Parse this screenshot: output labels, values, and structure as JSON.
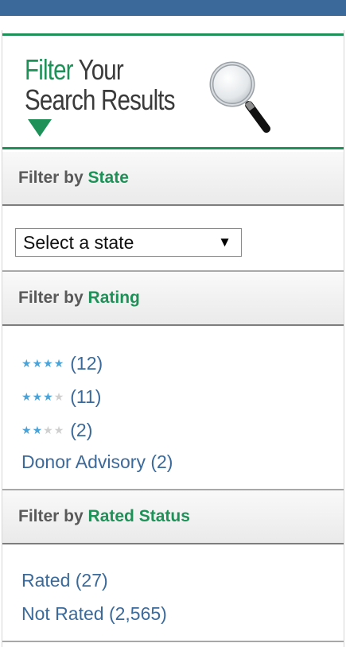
{
  "hero": {
    "title_green": "Filter",
    "title_dark1": "Your",
    "title_dark2": "Search Results",
    "icon": "magnifier-icon"
  },
  "state": {
    "filter_label": "Filter by",
    "filter_accent": "State",
    "select_value": "Select a state",
    "arrow": "▼"
  },
  "rating": {
    "filter_label": "Filter by",
    "filter_accent": "Rating",
    "star_glyph": "★",
    "items": [
      {
        "stars": 4,
        "count": "(12)"
      },
      {
        "stars": 3,
        "count": "(11)"
      },
      {
        "stars": 2,
        "count": "(2)"
      }
    ],
    "advisory": "Donor Advisory (2)"
  },
  "rated_status": {
    "filter_label": "Filter by",
    "filter_accent": "Rated Status",
    "items": [
      "Rated (27)",
      "Not Rated (2,565)"
    ]
  },
  "colors": {
    "green": "#1e9158",
    "link_blue": "#3b6a9a",
    "star_blue": "#4aa3d8",
    "header_bar": "#3b6a9a"
  }
}
